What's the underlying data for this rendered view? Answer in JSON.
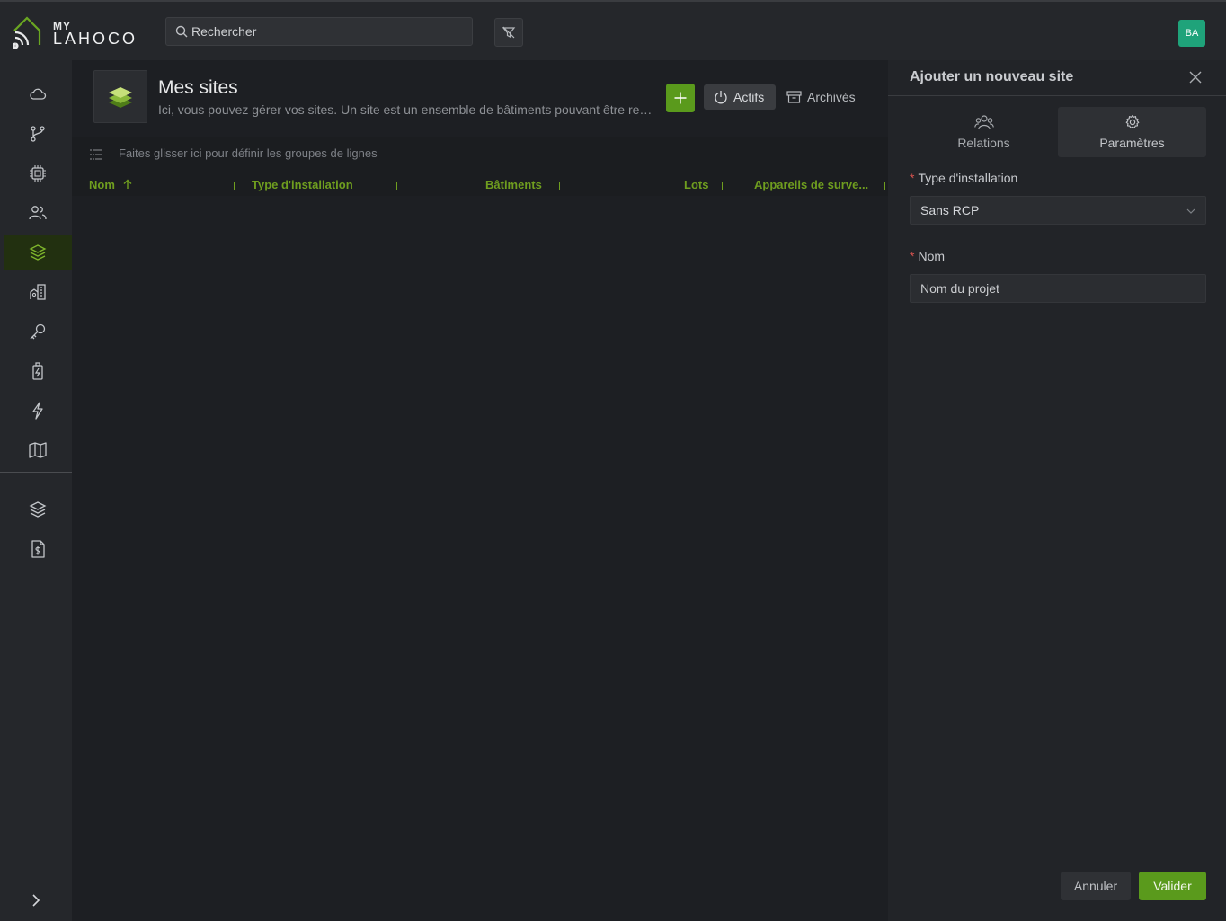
{
  "brand": {
    "line1": "MY",
    "line2": "LAHOCO",
    "accent": "#5a9a1c"
  },
  "search": {
    "placeholder": "Rechercher",
    "value": ""
  },
  "user": {
    "initials": "BA",
    "avatar_color": "#1fa37a"
  },
  "sidebar": {
    "items": [
      {
        "name": "cloud-icon"
      },
      {
        "name": "git-branch-icon"
      },
      {
        "name": "chip-icon"
      },
      {
        "name": "users-icon"
      },
      {
        "name": "layers-icon",
        "active": true
      },
      {
        "name": "building-icon"
      },
      {
        "name": "key-icon"
      },
      {
        "name": "battery-icon"
      },
      {
        "name": "lightning-icon"
      },
      {
        "name": "map-icon"
      }
    ],
    "bottom_items": [
      {
        "name": "layers-icon"
      },
      {
        "name": "invoice-icon"
      }
    ],
    "expand_icon": "chevron-right-icon"
  },
  "page": {
    "title": "Mes sites",
    "description": "Ici, vous pouvez gérer vos sites. Un site est un ensemble de bâtiments pouvant être regroupés",
    "filters": {
      "active": "Actifs",
      "archived": "Archivés"
    }
  },
  "grid": {
    "group_hint": "Faites glisser ici pour définir les groupes de lignes",
    "columns": [
      "Nom",
      "Type d'installation",
      "Bâtiments",
      "Lots",
      "Appareils de surve..."
    ]
  },
  "panel": {
    "title": "Ajouter un nouveau site",
    "tabs": [
      {
        "label": "Relations",
        "icon": "users-icon"
      },
      {
        "label": "Paramètres",
        "icon": "gear-icon",
        "active": true
      }
    ],
    "fields": {
      "install_type": {
        "label": "Type d'installation",
        "value": "Sans RCP"
      },
      "name": {
        "label": "Nom",
        "placeholder": "Nom du projet",
        "value": ""
      }
    },
    "actions": {
      "cancel": "Annuler",
      "submit": "Valider"
    }
  }
}
